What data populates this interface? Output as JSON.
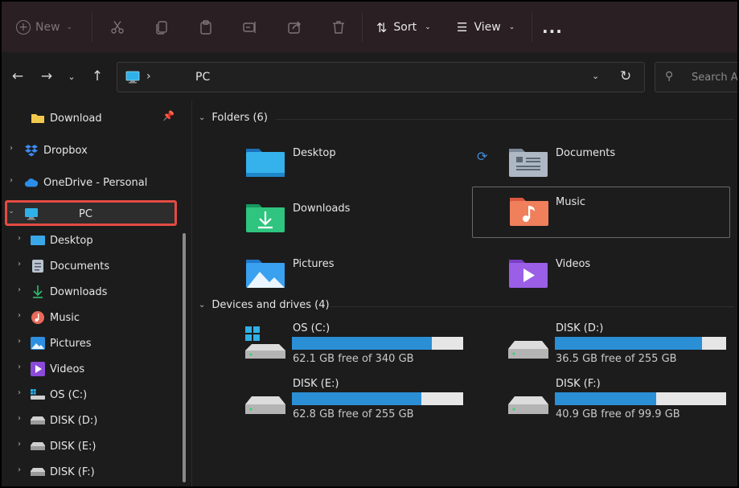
{
  "toolbar": {
    "new_label": "New",
    "sort_label": "Sort",
    "view_label": "View",
    "more_label": "..."
  },
  "address": {
    "separator": "›",
    "path": "PC"
  },
  "search": {
    "placeholder": "Search Ar"
  },
  "sidebar": {
    "items": [
      {
        "label": "Download",
        "icon": "folder-icon"
      },
      {
        "label": "Dropbox",
        "icon": "dropbox-icon"
      },
      {
        "label": "OneDrive - Personal",
        "icon": "cloud-icon"
      },
      {
        "label": "PC",
        "icon": "monitor-icon"
      },
      {
        "label": "Desktop",
        "icon": "desktop-icon"
      },
      {
        "label": "Documents",
        "icon": "documents-icon"
      },
      {
        "label": "Downloads",
        "icon": "download-arrow-icon"
      },
      {
        "label": "Music",
        "icon": "music-icon"
      },
      {
        "label": "Pictures",
        "icon": "pictures-icon"
      },
      {
        "label": "Videos",
        "icon": "videos-icon"
      },
      {
        "label": "OS (C:)",
        "icon": "os-drive-icon"
      },
      {
        "label": "DISK (D:)",
        "icon": "disk-icon"
      },
      {
        "label": "DISK (E:)",
        "icon": "disk-icon"
      },
      {
        "label": "DISK (F:)",
        "icon": "disk-icon"
      }
    ]
  },
  "main": {
    "folders_header": "Folders (6)",
    "devices_header": "Devices and drives (4)",
    "folders": [
      {
        "name": "Desktop"
      },
      {
        "name": "Documents"
      },
      {
        "name": "Downloads"
      },
      {
        "name": "Music"
      },
      {
        "name": "Pictures"
      },
      {
        "name": "Videos"
      }
    ],
    "drives": [
      {
        "name": "OS (C:)",
        "free_text": "62.1 GB free of 340 GB",
        "used_fraction": 0.817
      },
      {
        "name": "DISK (D:)",
        "free_text": "36.5 GB free of 255 GB",
        "used_fraction": 0.857
      },
      {
        "name": "DISK (E:)",
        "free_text": "62.8 GB free of 255 GB",
        "used_fraction": 0.754
      },
      {
        "name": "DISK (F:)",
        "free_text": "40.9 GB free of 99.9 GB",
        "used_fraction": 0.591
      }
    ]
  },
  "colors": {
    "accent": "#2b8fd5",
    "selection_outline": "#e34b43"
  }
}
